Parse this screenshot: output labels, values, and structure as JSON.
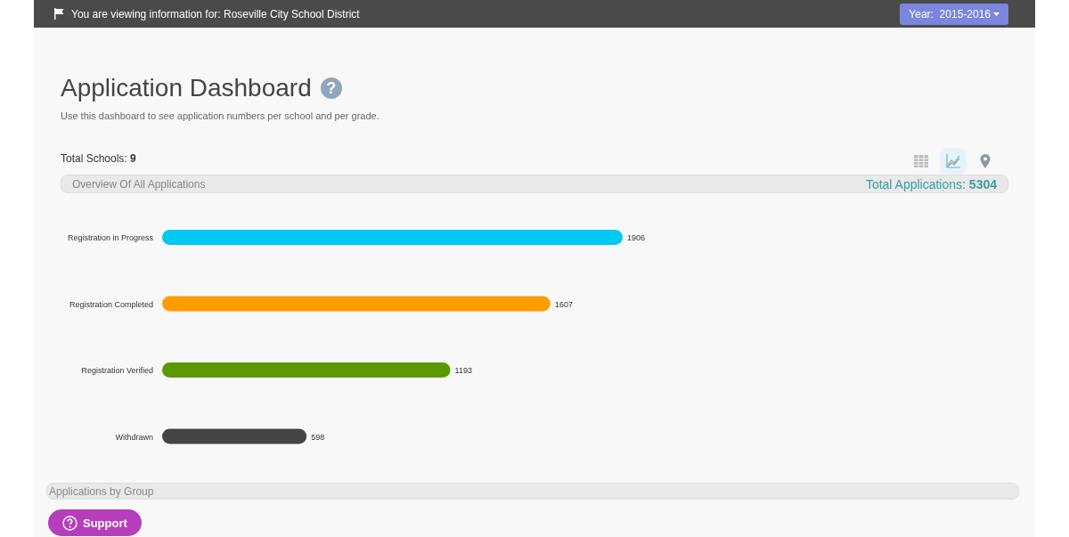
{
  "top_bar": {
    "message": "You are viewing information for: Roseville City School District",
    "year_button": "Year:  2015-2016"
  },
  "header": {
    "title": "Application Dashboard",
    "help_icon": "?",
    "subtitle": "Use this dashboard to see application numbers per school and per grade."
  },
  "summary": {
    "label": "Total Schools:",
    "value": "9"
  },
  "view_toggles": [
    {
      "kind": "table",
      "selected": false
    },
    {
      "kind": "chart",
      "selected": true
    },
    {
      "kind": "map",
      "selected": false
    }
  ],
  "overview": {
    "title": "Overview Of All Applications",
    "total_label": "Total Applications:",
    "total_value": "5304",
    "chart_data": {
      "type": "bar",
      "orientation": "horizontal",
      "data_labels": true,
      "categories": [
        "Registration in Progress",
        "Registration Completed",
        "Registration Verified",
        "Withdrawn"
      ],
      "values": [
        1906,
        1607,
        1193,
        598
      ],
      "colors": [
        "#00c8f0",
        "#ff9c00",
        "#5a9a00",
        "#444444"
      ]
    }
  },
  "group_section": {
    "title": "Applications by Group"
  },
  "support_button": "Support"
}
